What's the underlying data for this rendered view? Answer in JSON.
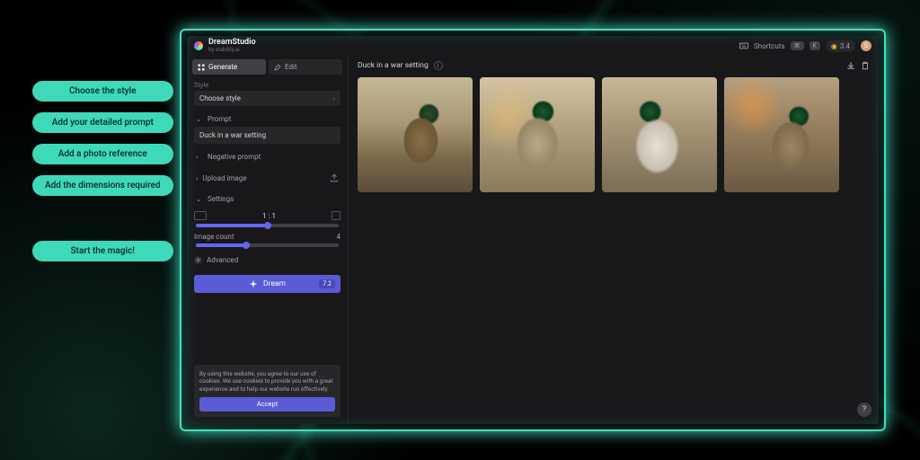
{
  "brand": {
    "name": "DreamStudio",
    "byline": "by stability.ai"
  },
  "topbar": {
    "shortcuts_label": "Shortcuts",
    "shortcut_key": "K",
    "credits": "3.4",
    "avatar_initial": "S"
  },
  "tabs": {
    "generate": "Generate",
    "edit": "Edit"
  },
  "style": {
    "label": "Style",
    "value": "Choose style"
  },
  "prompt": {
    "label": "Prompt",
    "value": "Duck in a war setting"
  },
  "negative": {
    "label": "Negative prompt"
  },
  "upload": {
    "label": "Upload image"
  },
  "settings": {
    "label": "Settings",
    "ratio": "1 : 1",
    "image_count_label": "Image count",
    "image_count_value": "4",
    "advanced": "Advanced"
  },
  "dream": {
    "label": "Dream",
    "cost": "7.2"
  },
  "cookie": {
    "text": "By using this website, you agree to our use of cookies. We use cookies to provide you with a great experience and to help our website run effectively.",
    "accept": "Accept"
  },
  "content": {
    "prompt_title": "Duck in a war setting"
  },
  "callouts": {
    "c1": "Choose the style",
    "c2": "Add your detailed prompt",
    "c3": "Add a photo reference",
    "c4": "Add the dimensions required",
    "c5": "Start the magic!"
  },
  "help": "?"
}
